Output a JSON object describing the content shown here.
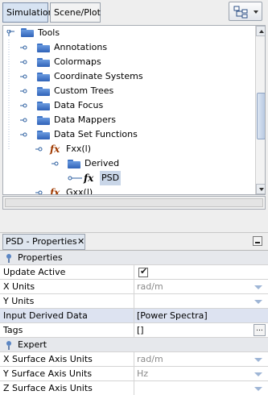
{
  "tabs": {
    "simulation": "Simulation",
    "scene": "Scene/Plot"
  },
  "tree": {
    "tools": "Tools",
    "annotations": "Annotations",
    "colormaps": "Colormaps",
    "coordinate_systems": "Coordinate Systems",
    "custom_trees": "Custom Trees",
    "data_focus": "Data Focus",
    "data_mappers": "Data Mappers",
    "data_set_functions": "Data Set Functions",
    "fxx": "Fxx(l)",
    "derived": "Derived",
    "psd": "PSD",
    "gxx": "Gxx(l)"
  },
  "properties": {
    "title": "PSD - Properties",
    "close_glyph": "✕",
    "cat_properties": "Properties",
    "update_active": "Update Active",
    "x_units": "X Units",
    "x_units_value": "rad/m",
    "y_units": "Y Units",
    "y_units_value": "",
    "input_derived_data": "Input Derived Data",
    "input_derived_data_value": "[Power Spectra]",
    "tags": "Tags",
    "tags_value": "[]",
    "tags_button": "...",
    "cat_expert": "Expert",
    "x_surface": "X Surface Axis Units",
    "x_surface_value": "rad/m",
    "y_surface": "Y Surface Axis Units",
    "y_surface_value": "Hz",
    "z_surface": "Z Surface Axis Units",
    "z_surface_value": ""
  },
  "colors": {
    "selection": "#c9d6e8",
    "highlight_row": "#dde3f1",
    "folder": "#3e74c6",
    "category_row": "#e6e8ec"
  }
}
